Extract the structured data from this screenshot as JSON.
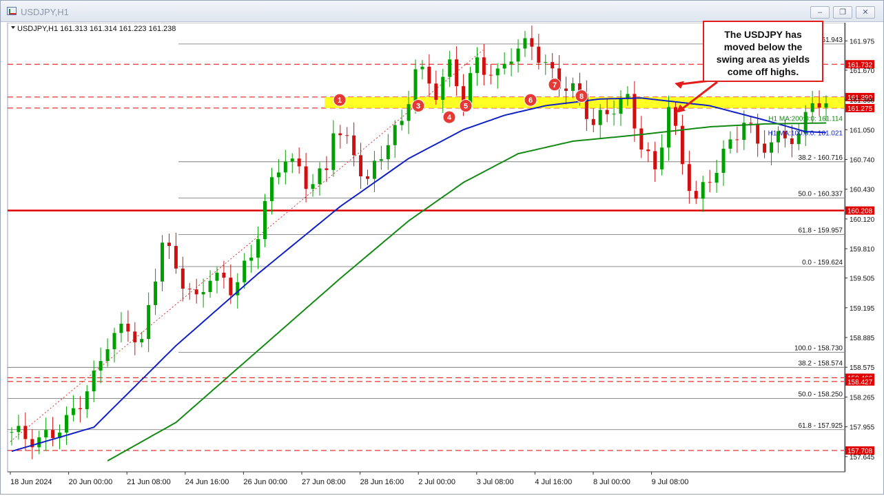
{
  "window": {
    "title": "USDJPY,H1",
    "buttons": [
      "minimize",
      "restore",
      "close"
    ]
  },
  "chart_data": {
    "type": "candlestick",
    "symbol_header": "USDJPY,H1  161.313 161.314 161.223 161.238",
    "ylim": [
      157.5,
      162.15
    ],
    "price_ticks": [
      "161.975",
      "161.670",
      "161.360",
      "161.050",
      "160.740",
      "160.430",
      "160.120",
      "159.810",
      "159.505",
      "159.195",
      "158.885",
      "158.575",
      "158.265",
      "157.955",
      "157.645"
    ],
    "date_ticks": [
      "18 Jun 2024",
      "20 Jun 00:00",
      "21 Jun 08:00",
      "24 Jun 16:00",
      "26 Jun 00:00",
      "27 Jun 08:00",
      "28 Jun 16:00",
      "2 Jul 00:00",
      "3 Jul 08:00",
      "4 Jul 16:00",
      "8 Jul 00:00",
      "9 Jul 08:00"
    ],
    "path": [
      [
        0,
        157.9
      ],
      [
        4,
        157.8
      ],
      [
        8,
        158.0
      ],
      [
        12,
        158.45
      ],
      [
        14,
        158.85
      ],
      [
        17,
        159.0
      ],
      [
        19,
        158.8
      ],
      [
        21,
        159.55
      ],
      [
        22,
        159.9
      ],
      [
        24,
        159.6
      ],
      [
        27,
        159.25
      ],
      [
        29,
        159.55
      ],
      [
        32,
        159.4
      ],
      [
        35,
        159.7
      ],
      [
        37,
        160.3
      ],
      [
        40,
        160.8
      ],
      [
        43,
        160.5
      ],
      [
        46,
        160.6
      ],
      [
        47,
        161.1
      ],
      [
        50,
        160.8
      ],
      [
        52,
        160.5
      ],
      [
        55,
        160.95
      ],
      [
        57,
        161.1
      ],
      [
        59,
        161.7
      ],
      [
        62,
        161.45
      ],
      [
        64,
        161.7
      ],
      [
        66,
        161.4
      ],
      [
        68,
        161.75
      ],
      [
        71,
        161.6
      ],
      [
        73,
        161.85
      ],
      [
        76,
        161.95
      ],
      [
        78,
        161.7
      ],
      [
        80,
        161.55
      ],
      [
        83,
        161.4
      ],
      [
        85,
        161.1
      ],
      [
        88,
        161.3
      ],
      [
        90,
        161.35
      ],
      [
        92,
        160.9
      ],
      [
        94,
        160.6
      ],
      [
        96,
        161.3
      ],
      [
        98,
        160.7
      ],
      [
        100,
        160.3
      ],
      [
        102,
        160.55
      ],
      [
        105,
        160.9
      ],
      [
        107,
        161.15
      ],
      [
        109,
        160.9
      ],
      [
        111,
        160.9
      ],
      [
        113,
        161.0
      ],
      [
        115,
        160.95
      ],
      [
        117,
        161.4
      ],
      [
        119,
        161.24
      ]
    ],
    "ma100": {
      "label": "H1 MA:100:0:0: 161.021",
      "points": [
        [
          0,
          157.7
        ],
        [
          12,
          157.95
        ],
        [
          24,
          158.8
        ],
        [
          36,
          159.55
        ],
        [
          48,
          160.25
        ],
        [
          58,
          160.75
        ],
        [
          66,
          161.05
        ],
        [
          72,
          161.2
        ],
        [
          78,
          161.3
        ],
        [
          86,
          161.37
        ],
        [
          92,
          161.38
        ],
        [
          102,
          161.3
        ],
        [
          110,
          161.15
        ],
        [
          116,
          161.03
        ],
        [
          119,
          161.02
        ]
      ]
    },
    "ma200": {
      "label": "H1 MA:200:0:0: 161.114",
      "points": [
        [
          14,
          157.6
        ],
        [
          24,
          158.0
        ],
        [
          36,
          158.75
        ],
        [
          48,
          159.5
        ],
        [
          58,
          160.1
        ],
        [
          66,
          160.5
        ],
        [
          74,
          160.8
        ],
        [
          82,
          160.93
        ],
        [
          92,
          161.0
        ],
        [
          102,
          161.08
        ],
        [
          110,
          161.11
        ],
        [
          119,
          161.12
        ]
      ]
    },
    "swing_zone": {
      "low": 161.275,
      "high": 161.39,
      "markers": [
        "1",
        "3",
        "4",
        "5",
        "6",
        "7",
        "8"
      ]
    },
    "fib_levels": [
      {
        "label": "161.943",
        "price": 161.943
      },
      {
        "label": "38.2 - 160.716",
        "price": 160.716
      },
      {
        "label": "50.0 - 160.337",
        "price": 160.337
      },
      {
        "label": "61.8 - 159.957",
        "price": 159.957
      },
      {
        "label": "0.0 - 159.624",
        "price": 159.624
      },
      {
        "label": "100.0 - 158.730",
        "price": 158.73
      },
      {
        "label": "38.2 - 158.574",
        "price": 158.574
      },
      {
        "label": "50.0 - 158.250",
        "price": 158.25
      },
      {
        "label": "61.8 - 157.925",
        "price": 157.925
      }
    ],
    "h_lines": [
      {
        "label": "161.732",
        "price": 161.732,
        "style": "dashed"
      },
      {
        "label": "161.390",
        "price": 161.39,
        "style": "dashed"
      },
      {
        "label": "161.275",
        "price": 161.275,
        "style": "dashed"
      },
      {
        "label": "160.208",
        "price": 160.208,
        "style": "solid"
      },
      {
        "label": "158.466",
        "price": 158.466,
        "style": "dashed"
      },
      {
        "label": "158.427",
        "price": 158.427,
        "style": "dashed"
      },
      {
        "label": "157.708",
        "price": 157.708,
        "style": "dashed"
      }
    ],
    "colors": {
      "up": "#00a000",
      "down": "#d01010",
      "ma100": "#1020c8",
      "ma200": "#128a12",
      "zone": "#ffff00",
      "level_red": "#e00000"
    }
  },
  "callout": {
    "lines": [
      "The USDJPY has",
      "moved below the",
      "swing area as yields",
      "come off highs."
    ]
  }
}
